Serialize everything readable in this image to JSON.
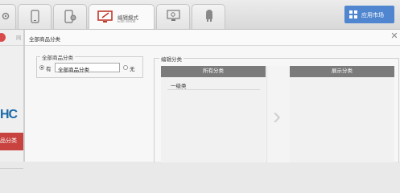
{
  "tabs": [
    {
      "icon": "gear-icon"
    },
    {
      "icon": "phone-icon"
    },
    {
      "icon": "phone-settings-icon"
    },
    {
      "icon": "edit-monitor-icon",
      "label": "编辑模式",
      "sublabel": "Edit Mode",
      "active": true
    },
    {
      "icon": "search-monitor-icon"
    },
    {
      "icon": "android-icon"
    }
  ],
  "app_market": {
    "label": "应用市场",
    "icon": "grid-icon"
  },
  "sidebar": {
    "logo_fragment": "HC",
    "category_button": "品分类",
    "divider_glyph": "网"
  },
  "dialog": {
    "title": "全部商品分类",
    "all_categories": {
      "legend": "全部商品分类",
      "option_yes": "有",
      "option_no": "无",
      "input_value": "全部商品分类"
    },
    "edit_categories": {
      "legend": "编辑分类",
      "all_panel_title": "所有分类",
      "display_panel_title": "展示分类",
      "items": [
        "一级类"
      ]
    }
  },
  "colors": {
    "accent": "#4f86cf",
    "category_red": "#c8433f",
    "panel_header": "#7b7b7b"
  }
}
